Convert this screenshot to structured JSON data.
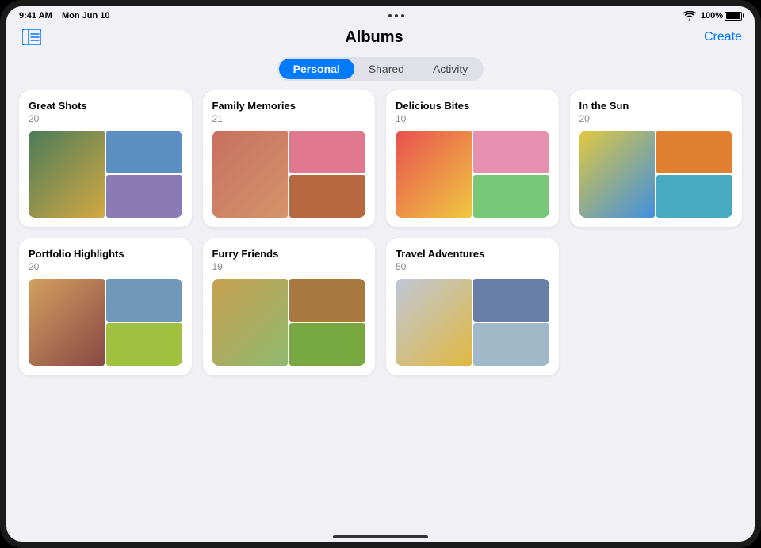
{
  "statusBar": {
    "time": "9:41 AM",
    "date": "Mon Jun 10",
    "battery": "100%",
    "wifi": true
  },
  "nav": {
    "title": "Albums",
    "createLabel": "Create",
    "sidebarIcon": "sidebar-icon"
  },
  "segmentedControl": {
    "options": [
      {
        "id": "personal",
        "label": "Personal",
        "active": true
      },
      {
        "id": "shared",
        "label": "Shared",
        "active": false
      },
      {
        "id": "activity",
        "label": "Activity",
        "active": false
      }
    ]
  },
  "albums": [
    {
      "id": "great-shots",
      "title": "Great Shots",
      "count": "20",
      "colors": [
        "p-green",
        "p-yellow",
        "p-blue",
        "p-purple"
      ]
    },
    {
      "id": "family-memories",
      "title": "Family Memories",
      "count": "21",
      "colors": [
        "p-brown",
        "p-red",
        "p-pink",
        "p-tan"
      ]
    },
    {
      "id": "delicious-bites",
      "title": "Delicious Bites",
      "count": "10",
      "colors": [
        "p-food1",
        "p-food2",
        "p-food3",
        "p-food4"
      ]
    },
    {
      "id": "in-the-sun",
      "title": "In the Sun",
      "count": "20",
      "colors": [
        "p-sun1",
        "p-sun2",
        "p-sun3",
        "p-teal"
      ]
    },
    {
      "id": "portfolio-highlights",
      "title": "Portfolio Highlights",
      "count": "20",
      "colors": [
        "p-port1",
        "p-port2",
        "p-port3",
        "p-port4"
      ]
    },
    {
      "id": "furry-friends",
      "title": "Furry Friends",
      "count": "19",
      "colors": [
        "p-dog1",
        "p-dog2",
        "p-dog3",
        "p-grass"
      ]
    },
    {
      "id": "travel-adventures",
      "title": "Travel Adventures",
      "count": "50",
      "colors": [
        "p-travel1",
        "p-travel2",
        "p-travel3",
        "p-sky"
      ]
    }
  ]
}
